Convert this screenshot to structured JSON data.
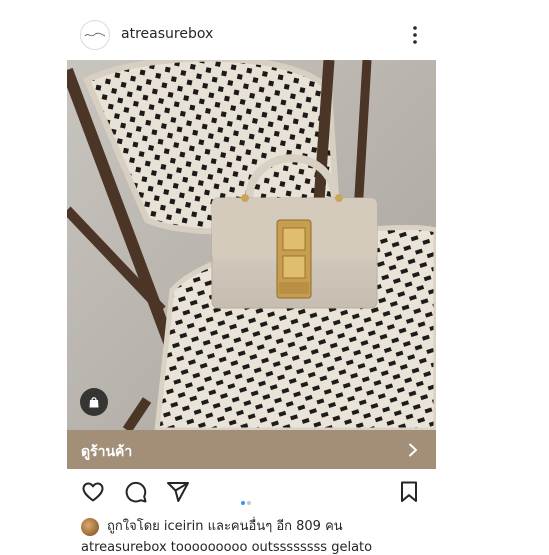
{
  "post": {
    "username": "atreasurebox",
    "shop_label": "ดูร้านค้า",
    "likes_prefix": "ถูกใจโดย",
    "likes_user": "iceirin",
    "likes_suffix": "และคนอื่นๆ อีก 809 คน",
    "caption_preview": "atreasurebox tooooooooo outssssssss gelato"
  },
  "colors": {
    "shop_bar": "#a38f78",
    "carousel_active": "#3897f0",
    "carousel_inactive": "#c7c7c7"
  },
  "icons": {
    "more": "more-vertical-icon",
    "shop": "shopping-bag-icon",
    "like": "heart-icon",
    "comment": "comment-icon",
    "share": "paper-plane-icon",
    "save": "bookmark-icon"
  },
  "carousel": {
    "count": 2,
    "active": 1
  }
}
